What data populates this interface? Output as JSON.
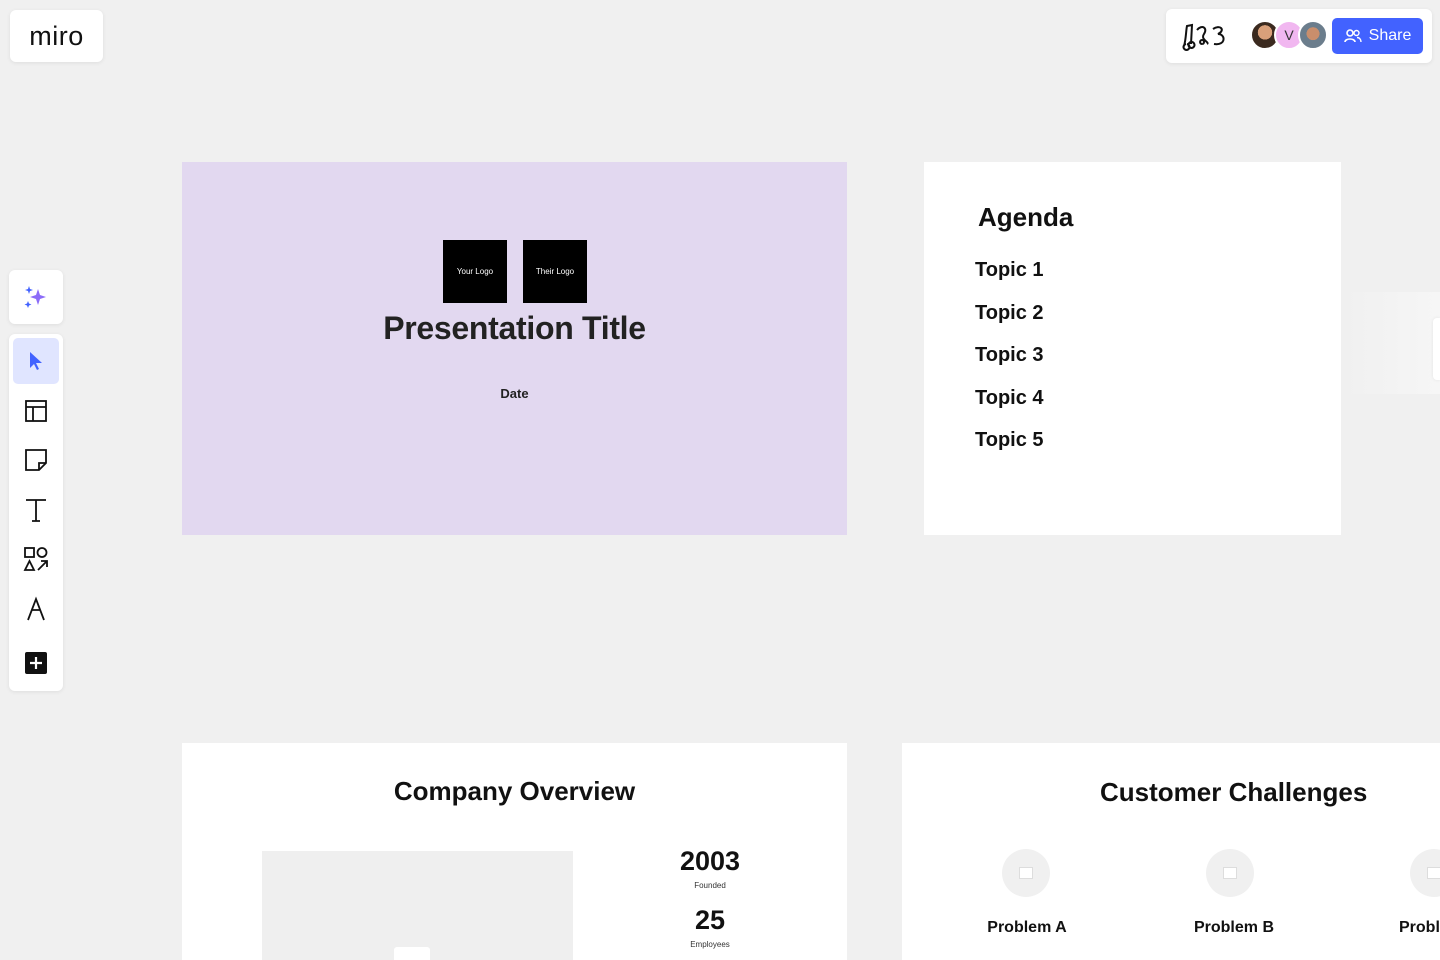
{
  "app": {
    "logo_text": "miro"
  },
  "header": {
    "share_label": "Share",
    "avatar_initial": "V"
  },
  "toolbar": {
    "tools": [
      {
        "name": "select",
        "icon": "cursor-icon",
        "active": true
      },
      {
        "name": "templates",
        "icon": "layout-icon",
        "active": false
      },
      {
        "name": "sticky-note",
        "icon": "sticky-note-icon",
        "active": false
      },
      {
        "name": "text",
        "icon": "text-icon",
        "active": false
      },
      {
        "name": "shapes",
        "icon": "shapes-icon",
        "active": false
      },
      {
        "name": "pen",
        "icon": "pen-icon",
        "active": false
      },
      {
        "name": "more",
        "icon": "plus-square-icon",
        "active": false
      }
    ],
    "ai_icon": "sparkles-icon"
  },
  "colors": {
    "accent": "#4262ff",
    "title_frame_bg": "#e2d8f0",
    "canvas_bg": "#f0f0f0",
    "ai_purple": "#8c6cf8"
  },
  "title_slide": {
    "logo_left": "Your Logo",
    "logo_right": "Their Logo",
    "title": "Presentation Title",
    "date": "Date"
  },
  "agenda": {
    "title": "Agenda",
    "items": [
      "Topic 1",
      "Topic 2",
      "Topic 3",
      "Topic 4",
      "Topic 5"
    ]
  },
  "overview": {
    "title": "Company Overview",
    "stats": [
      {
        "value": "2003",
        "label": "Founded"
      },
      {
        "value": "25",
        "label": "Employees"
      }
    ]
  },
  "challenges": {
    "title": "Customer Challenges",
    "problems": [
      "Problem A",
      "Problem B",
      "Probl"
    ]
  }
}
